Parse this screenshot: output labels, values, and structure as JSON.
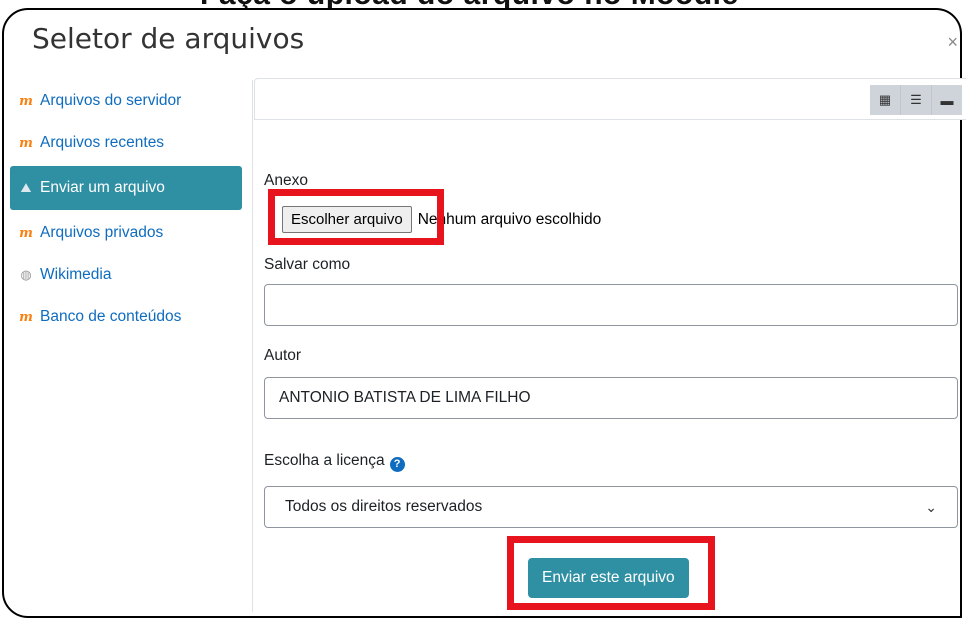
{
  "top_strip_text": "Faça o upload do arquivo no Moodle",
  "dialog": {
    "title": "Seletor de arquivos",
    "close_label": "×"
  },
  "sidebar": {
    "items": [
      {
        "label": "Arquivos do servidor",
        "icon": "moodle-icon",
        "active": false
      },
      {
        "label": "Arquivos recentes",
        "icon": "moodle-icon",
        "active": false
      },
      {
        "label": "Enviar um arquivo",
        "icon": "upload-icon",
        "active": true
      },
      {
        "label": "Arquivos privados",
        "icon": "moodle-icon",
        "active": false
      },
      {
        "label": "Wikimedia",
        "icon": "wikimedia-icon",
        "active": false
      },
      {
        "label": "Banco de conteúdos",
        "icon": "moodle-icon",
        "active": false
      }
    ]
  },
  "toolbar": {
    "views": [
      "grid-view-icon",
      "list-view-icon",
      "folder-view-icon"
    ]
  },
  "form": {
    "attachment_label": "Anexo",
    "file_button": "Escolher arquivo",
    "file_status": "Nenhum arquivo escolhido",
    "save_as_label": "Salvar como",
    "save_as_value": "",
    "author_label": "Autor",
    "author_value": "ANTONIO BATISTA DE LIMA FILHO",
    "license_label": "Escolha a licença",
    "license_value": "Todos os direitos reservados",
    "submit_label": "Enviar este arquivo"
  },
  "colors": {
    "accent": "#2f8fa3",
    "link": "#0f6cbf",
    "highlight": "#e8141d",
    "moodle": "#f98012"
  }
}
